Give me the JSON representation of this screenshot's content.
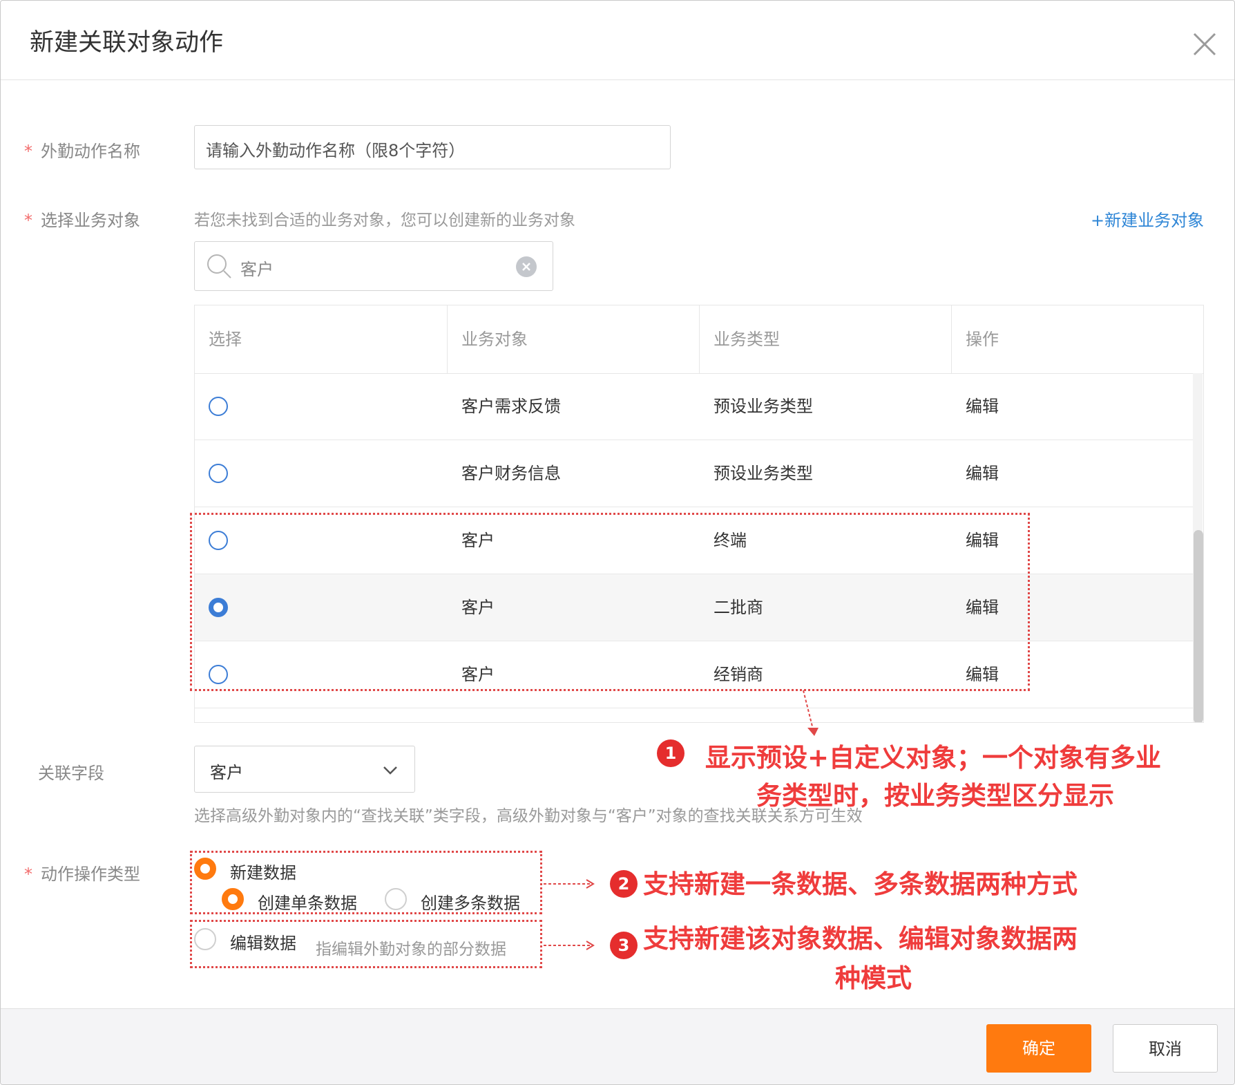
{
  "dialog": {
    "title": "新建关联对象动作"
  },
  "form": {
    "action_name": {
      "label": "外勤动作名称",
      "required_mark": "*",
      "placeholder": "请输入外勤动作名称（限8个字符）"
    },
    "business_object": {
      "label": "选择业务对象",
      "required_mark": "*",
      "hint": "若您未找到合适的业务对象，您可以创建新的业务对象",
      "new_link": "+新建业务对象",
      "search_value": "客户"
    },
    "table": {
      "headers": [
        "选择",
        "业务对象",
        "业务类型",
        "操作"
      ],
      "rows": [
        {
          "object": "客户需求反馈",
          "type": "预设业务类型",
          "action": "编辑",
          "selected": false
        },
        {
          "object": "客户财务信息",
          "type": "预设业务类型",
          "action": "编辑",
          "selected": false
        },
        {
          "object": "客户",
          "type": "终端",
          "action": "编辑",
          "selected": false
        },
        {
          "object": "客户",
          "type": "二批商",
          "action": "编辑",
          "selected": true
        },
        {
          "object": "客户",
          "type": "经销商",
          "action": "编辑",
          "selected": false
        }
      ]
    },
    "related_field": {
      "label": "关联字段",
      "value": "客户",
      "hint": "选择高级外勤对象内的“查找关联”类字段，高级外勤对象与“客户”对象的查找关联关系方可生效"
    },
    "action_type": {
      "label": "动作操作类型",
      "required_mark": "*",
      "new_data": "新建数据",
      "single": "创建单条数据",
      "multi": "创建多条数据",
      "edit_data": "编辑数据",
      "edit_hint": "指编辑外勤对象的部分数据"
    }
  },
  "annotations": [
    {
      "num": "1",
      "line1": "显示预设+自定义对象；一个对象有多业",
      "line2": "务类型时，按业务类型区分显示"
    },
    {
      "num": "2",
      "line1": "支持新建一条数据、多条数据两种方式"
    },
    {
      "num": "3",
      "line1": "支持新建该对象数据、编辑对象数据两",
      "line2": "种模式"
    }
  ],
  "footer": {
    "ok": "确定",
    "cancel": "取消"
  },
  "colors": {
    "primary": "#ff7a0f",
    "link": "#2f86d6",
    "radio_blue": "#3c7dd6",
    "annotation_red": "#ef3c3c"
  }
}
